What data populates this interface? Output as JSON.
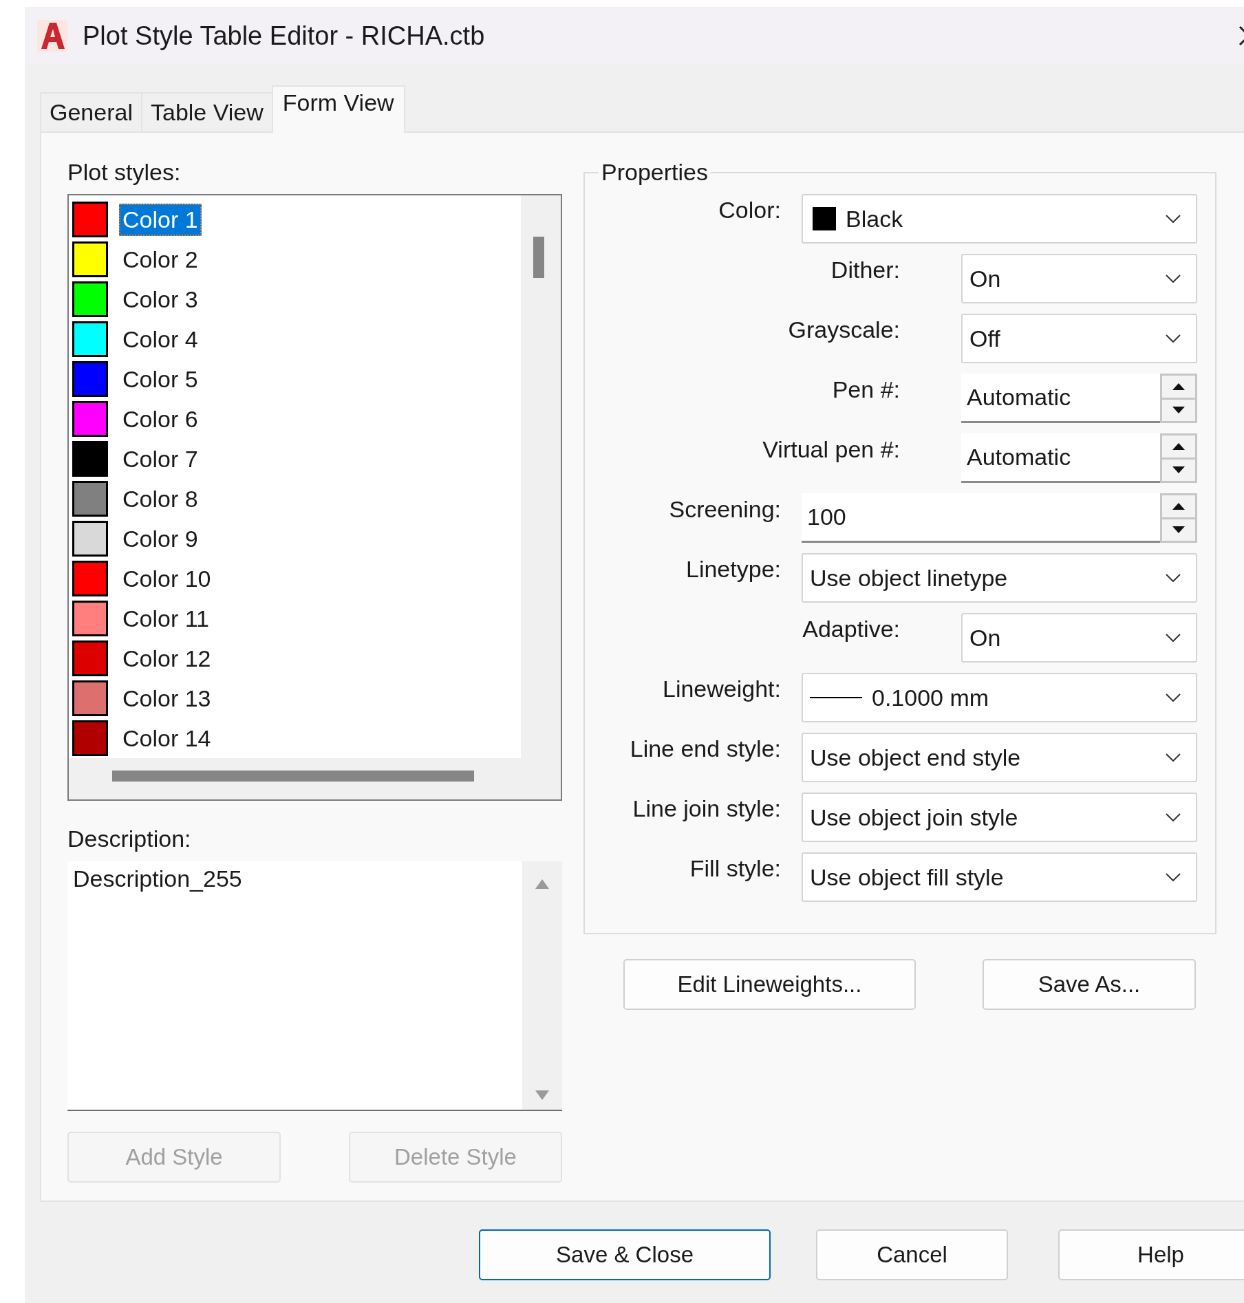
{
  "window": {
    "title": "Plot Style Table Editor - RICHA.ctb"
  },
  "tabs": [
    {
      "label": "General",
      "selected": false
    },
    {
      "label": "Table View",
      "selected": false
    },
    {
      "label": "Form View",
      "selected": true
    }
  ],
  "plot_styles": {
    "label": "Plot styles:",
    "items": [
      {
        "label": "Color 1",
        "color": "#ff0000",
        "selected": true
      },
      {
        "label": "Color 2",
        "color": "#ffff00",
        "selected": false
      },
      {
        "label": "Color 3",
        "color": "#00ff00",
        "selected": false
      },
      {
        "label": "Color 4",
        "color": "#00ffff",
        "selected": false
      },
      {
        "label": "Color 5",
        "color": "#0000ff",
        "selected": false
      },
      {
        "label": "Color 6",
        "color": "#ff00ff",
        "selected": false
      },
      {
        "label": "Color 7",
        "color": "#000000",
        "selected": false
      },
      {
        "label": "Color 8",
        "color": "#808080",
        "selected": false
      },
      {
        "label": "Color 9",
        "color": "#d9d9d9",
        "selected": false
      },
      {
        "label": "Color 10",
        "color": "#ff0000",
        "selected": false
      },
      {
        "label": "Color 11",
        "color": "#ff7f7f",
        "selected": false
      },
      {
        "label": "Color 12",
        "color": "#dd0000",
        "selected": false
      },
      {
        "label": "Color 13",
        "color": "#dd6f6f",
        "selected": false
      },
      {
        "label": "Color 14",
        "color": "#b00000",
        "selected": false
      }
    ]
  },
  "description": {
    "label": "Description:",
    "value": "Description_255"
  },
  "style_buttons": [
    {
      "label": "Add Style",
      "disabled": true
    },
    {
      "label": "Delete Style",
      "disabled": true
    }
  ],
  "properties": {
    "title": "Properties",
    "fields": [
      {
        "kind": "color",
        "label": "Color:",
        "value": "Black",
        "color": "#000000"
      },
      {
        "kind": "dropdown",
        "label": "Dither:",
        "value": "On"
      },
      {
        "kind": "dropdown",
        "label": "Grayscale:",
        "value": "Off"
      },
      {
        "kind": "spinner",
        "label": "Pen #:",
        "value": "Automatic"
      },
      {
        "kind": "spinner",
        "label": "Virtual pen #:",
        "value": "Automatic"
      },
      {
        "kind": "spinner",
        "label": "Screening:",
        "value": "100"
      },
      {
        "kind": "dropdown",
        "label": "Linetype:",
        "value": "Use object linetype"
      },
      {
        "kind": "dropdown",
        "label": "Adaptive:",
        "value": "On"
      },
      {
        "kind": "lineweight",
        "label": "Lineweight:",
        "value": "0.1000 mm"
      },
      {
        "kind": "dropdown",
        "label": "Line end style:",
        "value": "Use object end style"
      },
      {
        "kind": "dropdown",
        "label": "Line join style:",
        "value": "Use object join style"
      },
      {
        "kind": "dropdown",
        "label": "Fill style:",
        "value": "Use object fill style"
      }
    ]
  },
  "property_buttons": [
    {
      "label": "Edit Lineweights...",
      "disabled": false
    },
    {
      "label": "Save As...",
      "disabled": false
    }
  ],
  "dialog_buttons": [
    {
      "label": "Save & Close",
      "default": true
    },
    {
      "label": "Cancel",
      "default": false
    },
    {
      "label": "Help",
      "default": false
    }
  ]
}
